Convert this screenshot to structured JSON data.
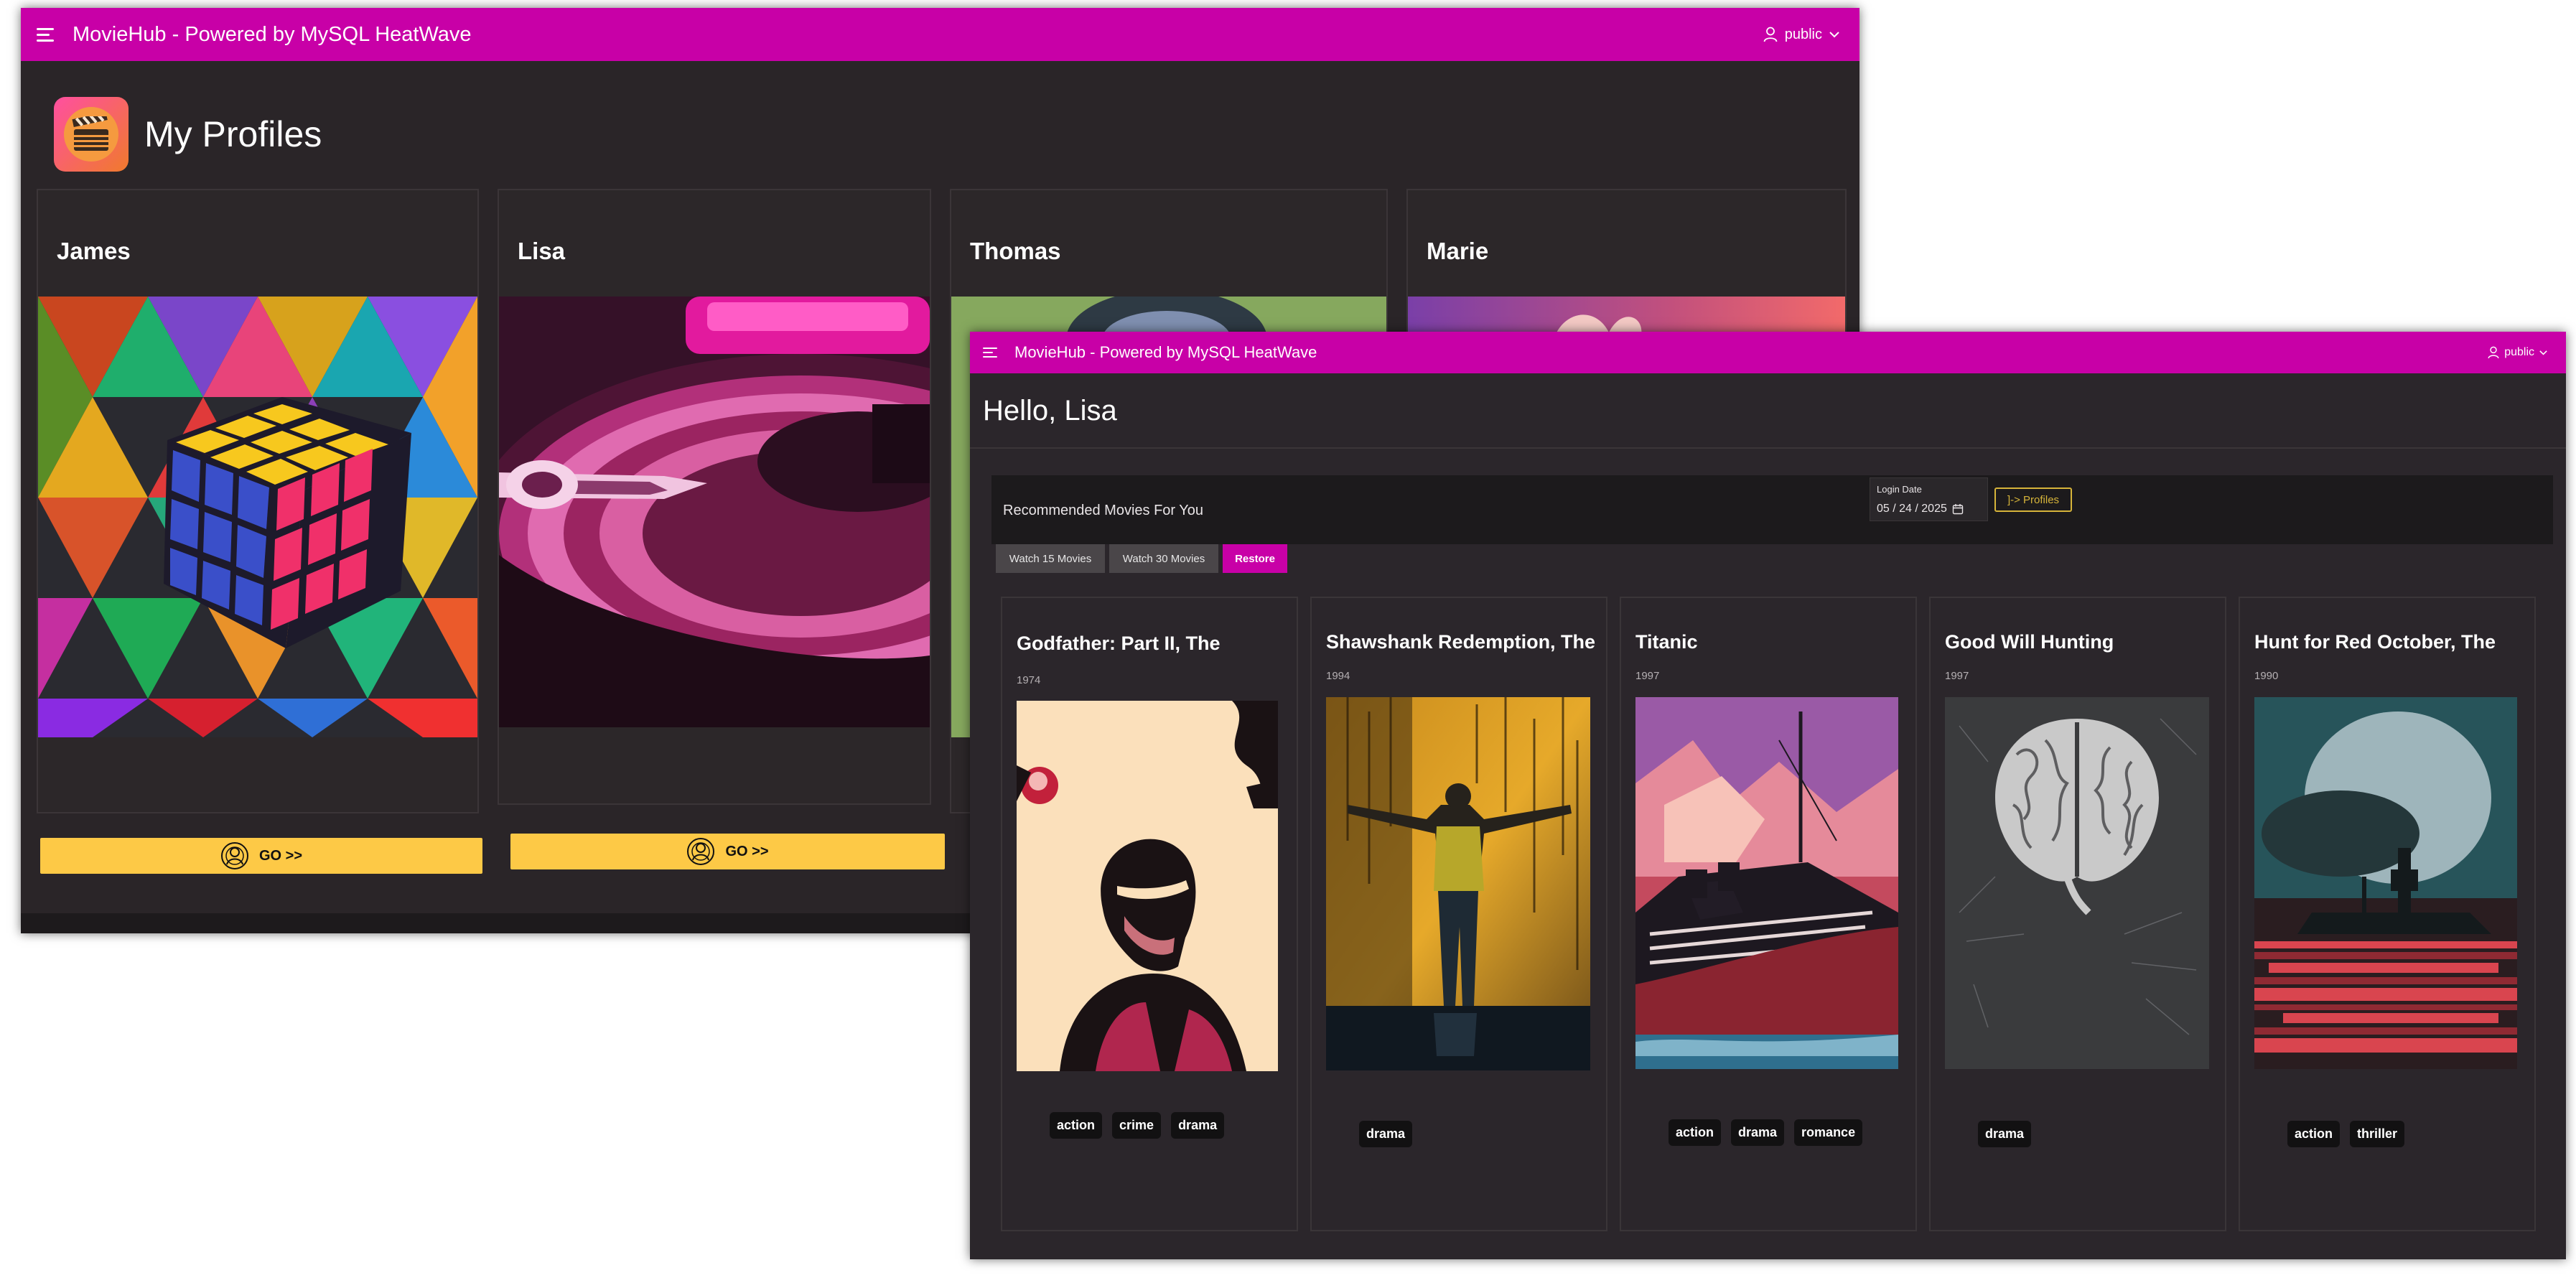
{
  "back_window": {
    "app_title": "MovieHub - Powered by MySQL HeatWave",
    "user_label": "public",
    "page_title": "My Profiles",
    "profiles": [
      {
        "name": "James",
        "button": "GO >>"
      },
      {
        "name": "Lisa",
        "button": "GO >>"
      },
      {
        "name": "Thomas"
      },
      {
        "name": "Marie"
      }
    ]
  },
  "front_window": {
    "app_title": "MovieHub - Powered by MySQL HeatWave",
    "user_label": "public",
    "greeting": "Hello, Lisa",
    "section_title": "Recommended Movies For You",
    "login_date": {
      "label": "Login Date",
      "value": "05 / 24 / 2025"
    },
    "profiles_button": "]-> Profiles",
    "action_buttons": [
      {
        "label": "Watch 15 Movies"
      },
      {
        "label": "Watch 30 Movies"
      },
      {
        "label": "Restore"
      }
    ],
    "movies": [
      {
        "title": "Godfather: Part II, The",
        "year": "1974",
        "genres": [
          "action",
          "crime",
          "drama"
        ]
      },
      {
        "title": "Shawshank Redemption, The",
        "year": "1994",
        "genres": [
          "drama"
        ]
      },
      {
        "title": "Titanic",
        "year": "1997",
        "genres": [
          "action",
          "drama",
          "romance"
        ]
      },
      {
        "title": "Good Will Hunting",
        "year": "1997",
        "genres": [
          "drama"
        ]
      },
      {
        "title": "Hunt for Red October, The",
        "year": "1990",
        "genres": [
          "action",
          "thriller"
        ]
      }
    ]
  },
  "colors": {
    "header": "#c800a7",
    "go_button": "#fdc946",
    "restore_button": "#c800a7",
    "secondary_button": "#4a4649",
    "background": "#2a2528"
  }
}
